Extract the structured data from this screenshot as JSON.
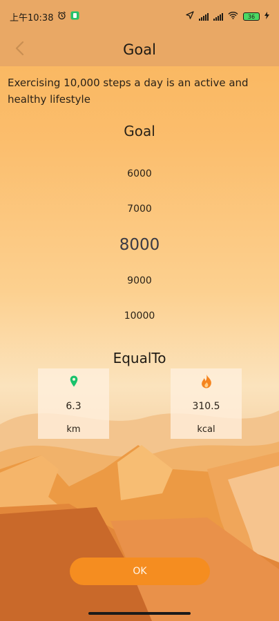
{
  "status_bar": {
    "time": "上午10:38",
    "battery": "36"
  },
  "header": {
    "title": "Goal"
  },
  "intro_text": "Exercising 10,000 steps a day is an active and healthy lifestyle",
  "goal": {
    "label": "Goal",
    "options": [
      "6000",
      "7000",
      "8000",
      "9000",
      "10000"
    ],
    "selected": "8000"
  },
  "equal_to": {
    "label": "EqualTo",
    "distance": {
      "value": "6.3",
      "unit": "km",
      "icon": "location-pin-icon"
    },
    "calories": {
      "value": "310.5",
      "unit": "kcal",
      "icon": "flame-icon"
    }
  },
  "ok_button": {
    "label": "OK"
  },
  "colors": {
    "accent": "#f58d20",
    "header_bg": "#e9a865",
    "pin": "#19c26b",
    "flame": "#f5841f"
  }
}
